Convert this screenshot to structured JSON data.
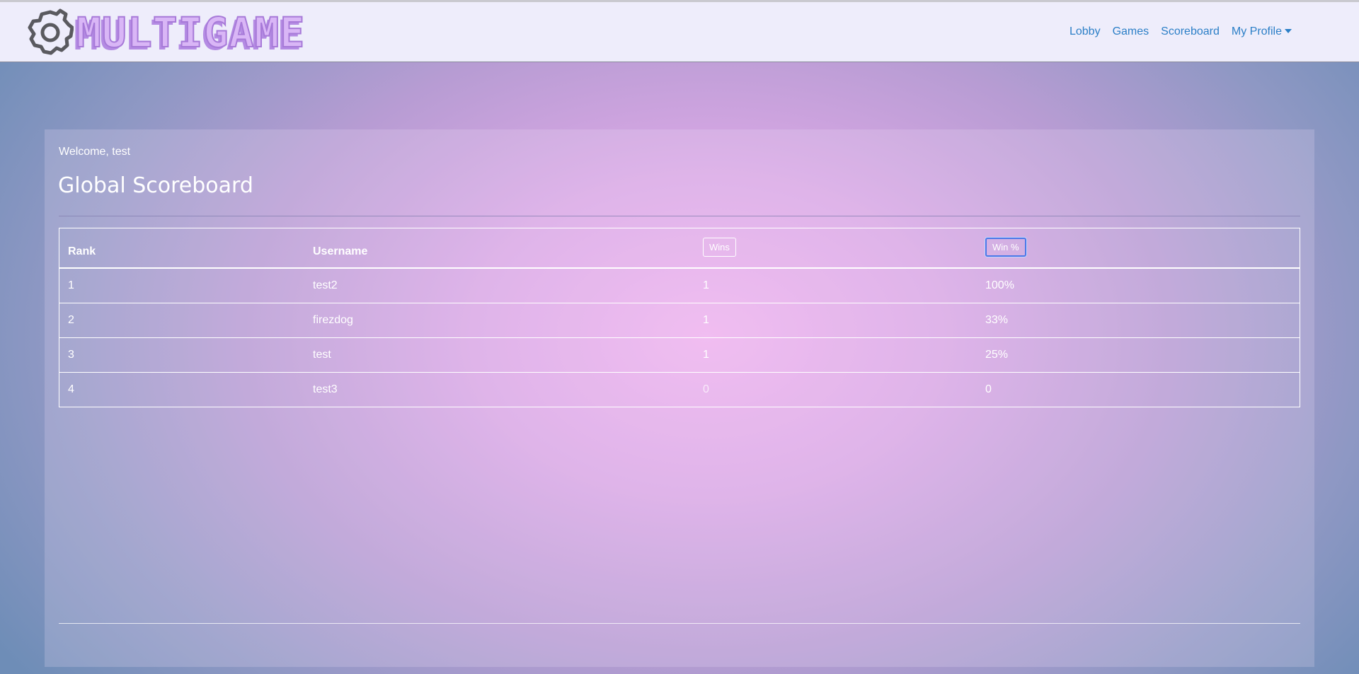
{
  "brand": {
    "logo_text": "MULTIGAME"
  },
  "nav": {
    "items": [
      {
        "label": "Lobby"
      },
      {
        "label": "Games"
      },
      {
        "label": "Scoreboard"
      },
      {
        "label": "My Profile"
      }
    ]
  },
  "page": {
    "welcome": "Welcome, test",
    "title": "Global Scoreboard"
  },
  "table": {
    "headers": {
      "rank": "Rank",
      "username": "Username",
      "wins": "Wins",
      "win_pct": "Win %"
    },
    "rows": [
      {
        "rank": "1",
        "username": "test2",
        "wins": "1",
        "win_pct": "100%"
      },
      {
        "rank": "2",
        "username": "firezdog",
        "wins": "1",
        "win_pct": "33%"
      },
      {
        "rank": "3",
        "username": "test",
        "wins": "1",
        "win_pct": "25%"
      },
      {
        "rank": "4",
        "username": "test3",
        "wins": "0",
        "win_pct": "0"
      }
    ]
  },
  "colors": {
    "nav_link": "#2b7fc7",
    "navbar_bg": "#eeedfb",
    "focus_ring": "#4b78e8"
  }
}
